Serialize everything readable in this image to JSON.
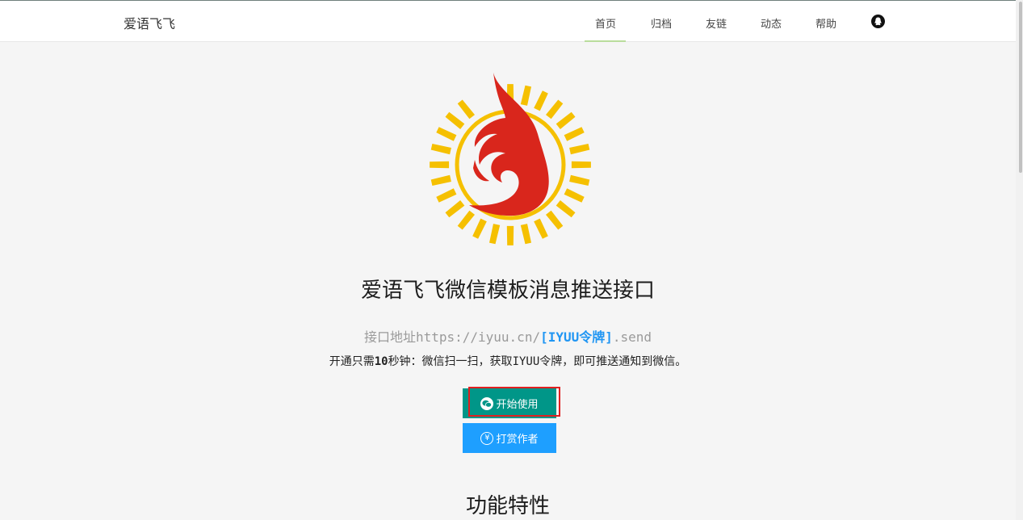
{
  "brand": "爱语飞飞",
  "nav": {
    "home": "首页",
    "archive": "归档",
    "links": "友链",
    "news": "动态",
    "help": "帮助"
  },
  "hero": {
    "title": "爱语飞飞微信模板消息推送接口",
    "api_prefix": "接口地址",
    "api_url": "https://iyuu.cn/",
    "api_token": "[IYUU令牌]",
    "api_suffix": ".send",
    "desc_a": "开通只需",
    "desc_num": "10",
    "desc_b": "秒钟：微信扫一扫，获取",
    "desc_iyuu": "IYUU",
    "desc_c": "令牌，即可推送通知到微信。"
  },
  "buttons": {
    "start": "开始使用",
    "reward": "打赏作者",
    "reward_icon_glyph": "¥"
  },
  "section_title": "功能特性",
  "colors": {
    "start_button": "#009688",
    "reward_button": "#1e9fff",
    "token": "#2196f3",
    "flame": "#d9261c",
    "sun": "#f5c000",
    "highlight": "#e02020"
  },
  "icons": {
    "user": "qq-user-icon",
    "wechat": "wechat-icon",
    "reward": "yen-circle-icon"
  }
}
